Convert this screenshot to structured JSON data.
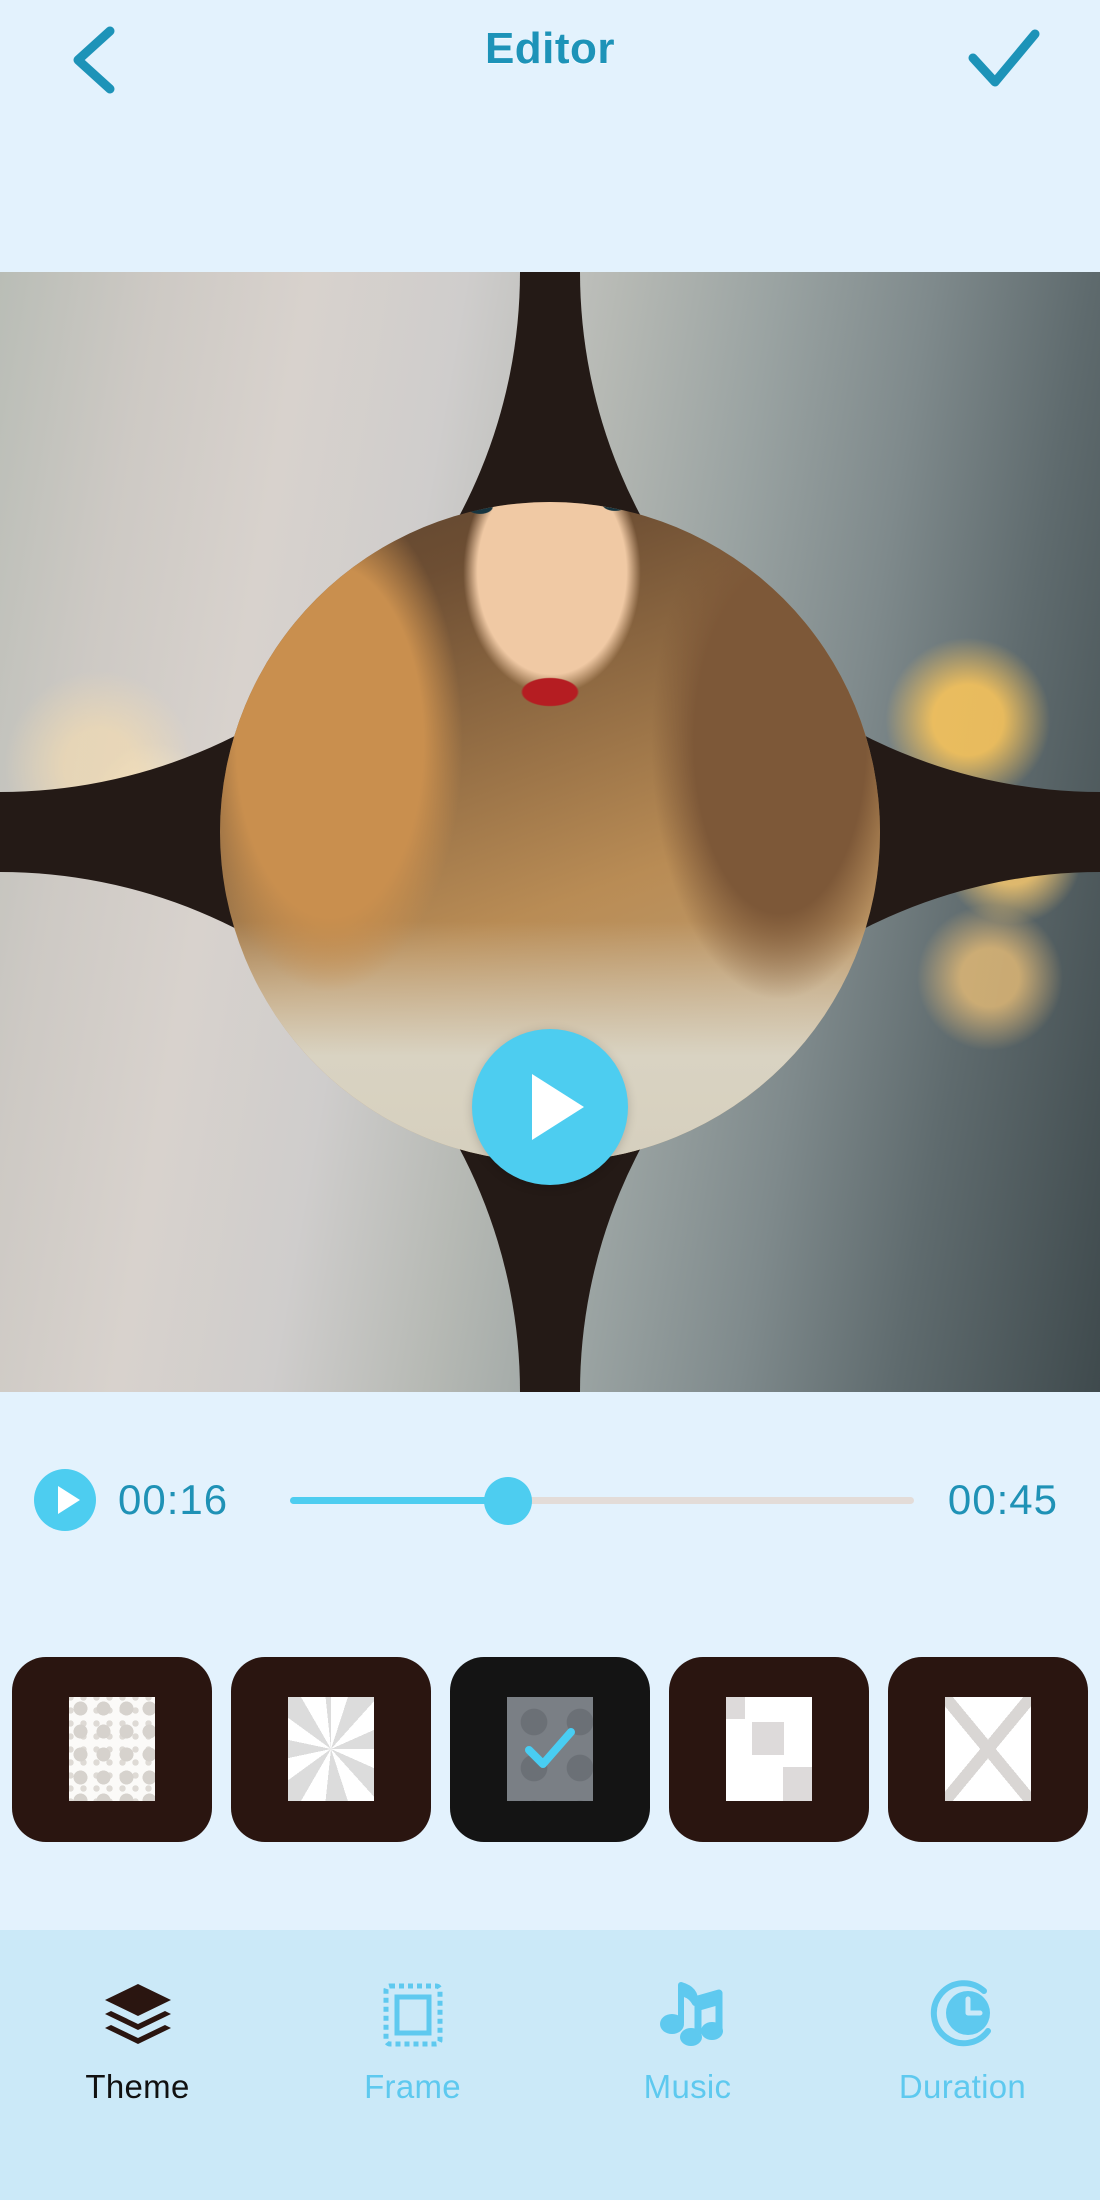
{
  "app": {
    "background_color": "#e3f2fd",
    "accent_color": "#4dcdf0",
    "title_color": "#1d93b8"
  },
  "header": {
    "title": "Editor",
    "back_icon": "chevron-left-icon",
    "confirm_icon": "check-icon"
  },
  "preview": {
    "play_icon": "play-icon",
    "effect": "circle-petal-transition"
  },
  "timeline": {
    "play_icon": "play-icon",
    "current_time": "00:16",
    "total_time": "00:45",
    "progress_percent": 35,
    "track_color": "#e3dcd8",
    "fill_color": "#4dcdf0"
  },
  "themes": {
    "selected_index": 2,
    "items": [
      {
        "name": "dots",
        "label": "Dots"
      },
      {
        "name": "pinwheel",
        "label": "Pinwheel"
      },
      {
        "name": "circles",
        "label": "Circles"
      },
      {
        "name": "blocks",
        "label": "Blocks"
      },
      {
        "name": "cross",
        "label": "Cross"
      }
    ]
  },
  "bottom_nav": {
    "active_index": 0,
    "items": [
      {
        "label": "Theme",
        "icon": "layers-icon"
      },
      {
        "label": "Frame",
        "icon": "frame-icon"
      },
      {
        "label": "Music",
        "icon": "music-notes-icon"
      },
      {
        "label": "Duration",
        "icon": "clock-icon"
      }
    ]
  }
}
